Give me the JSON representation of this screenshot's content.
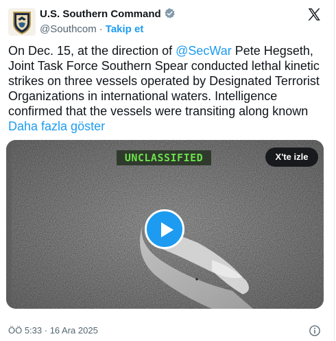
{
  "author": {
    "display_name": "U.S. Southern Command",
    "handle": "@Southcom",
    "separator": "·",
    "follow_label": "Takip et"
  },
  "tweet": {
    "text_before": "On Dec. 15, at the direction of ",
    "mention": "@SecWar",
    "text_after": " Pete Hegseth, Joint Task Force Southern Spear conducted lethal kinetic strikes on three vessels operated by Designated Terrorist Organizations in international waters. Intelligence confirmed that the vessels were transiting along known ",
    "show_more": "Daha fazla göster"
  },
  "media": {
    "overlay_label": "UNCLASSIFIED",
    "watch_label": "X'te izle"
  },
  "footer": {
    "timestamp": "ÖÖ 5:33 · 16 Ara 2025"
  },
  "icons": {
    "avatar": "southcom-seal-icon",
    "verified": "verified-badge-icon",
    "brand": "x-logo-icon",
    "play": "play-icon",
    "info": "info-icon"
  },
  "colors": {
    "accent": "#1d9bf0",
    "text": "#0f1419",
    "muted": "#536471",
    "label_green": "#6ce24a"
  }
}
